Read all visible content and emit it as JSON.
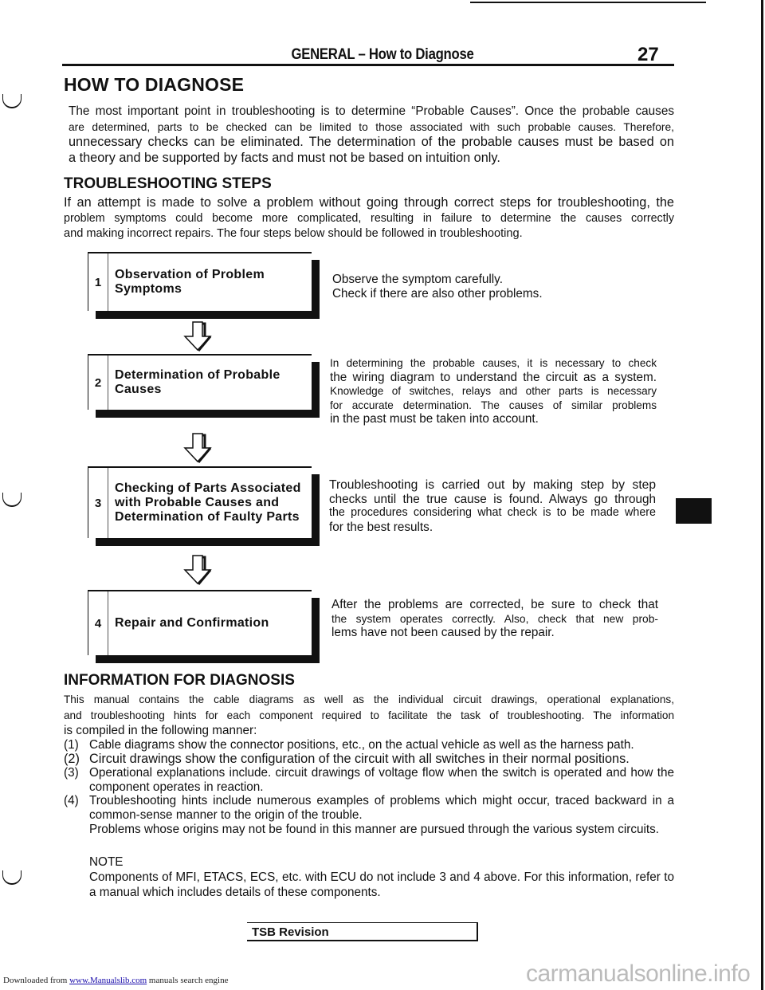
{
  "header": {
    "title": "GENERAL – How to Diagnose",
    "page_number": "27"
  },
  "section_how": {
    "heading": "HOW TO DIAGNOSE",
    "lines": [
      "The most important point in troubleshooting is to determine “Probable Causes”. Once the probable causes",
      "are determined, parts to be checked can be limited to those associated with such probable causes. Therefore,",
      "unnecessary checks can be eliminated. The determination of the probable causes must be based on",
      "a theory and be supported by facts and must not be based on intuition only."
    ]
  },
  "section_steps": {
    "heading": "TROUBLESHOOTING STEPS",
    "lines": [
      "If an attempt is made to solve a problem without going through correct steps for troubleshooting, the",
      "problem symptoms could become more complicated, resulting in failure to determine the causes correctly",
      "and making incorrect repairs. The four steps below should be followed in troubleshooting."
    ],
    "steps": [
      {
        "number": "1",
        "title": "Observation of Problem Symptoms",
        "description_lines": [
          "Observe the symptom carefully.",
          "Check if there are also other problems."
        ]
      },
      {
        "number": "2",
        "title": "Determination of Probable Causes",
        "description_lines": [
          "In determining the probable causes, it is necessary to check",
          "the wiring diagram to understand the circuit as a system.",
          "Knowledge of switches, relays and other parts is necessary",
          "for accurate determination. The causes of similar problems",
          "in the past must be taken into account."
        ]
      },
      {
        "number": "3",
        "title": "Checking of Parts Associated with Probable Causes and Determination of Faulty Parts",
        "description_lines": [
          "Troubleshooting is carried out by making step by step",
          "checks until the true cause is found. Always go through",
          "the procedures considering what check is to be made where",
          "for the best results."
        ]
      },
      {
        "number": "4",
        "title": "Repair and Confirmation",
        "description_lines": [
          "After the problems are corrected, be sure to check that",
          "the system operates correctly. Also, check that new prob-",
          "lems have not been caused by the repair."
        ]
      }
    ]
  },
  "section_info": {
    "heading": "INFORMATION FOR DIAGNOSIS",
    "lines": [
      "This manual contains the cable diagrams as well as the individual circuit drawings, operational explanations,",
      "and troubleshooting hints for each component required to facilitate the task of troubleshooting. The information",
      "is compiled in the following manner:"
    ],
    "items": [
      {
        "num": "(1)",
        "text": "Cable diagrams show the connector positions, etc., on the actual vehicle as well as the harness path."
      },
      {
        "num": "(2)",
        "text": "Circuit drawings show the configuration of the circuit with all switches in their normal positions."
      },
      {
        "num": "(3)",
        "text": "Operational explanations include. circuit drawings of voltage flow when the switch is operated and how the component operates in reaction."
      },
      {
        "num": "(4)",
        "text": "Troubleshooting hints include numerous examples of problems which might occur, traced backward in a common-sense manner to the origin of the trouble."
      }
    ],
    "item4_extra": "Problems whose origins may not be found in this manner are pursued through the various system circuits.",
    "note_label": "NOTE",
    "note_text": "Components of MFI, ETACS, ECS, etc. with ECU do not include 3 and 4 above. For this information, refer to a manual which includes details of these components."
  },
  "footer": {
    "tsb_label": "TSB Revision",
    "downloaded_prefix": "Downloaded from ",
    "downloaded_link": "www.Manualslib.com",
    "downloaded_suffix": " manuals search engine",
    "watermark": "carmanualsonline.info"
  }
}
